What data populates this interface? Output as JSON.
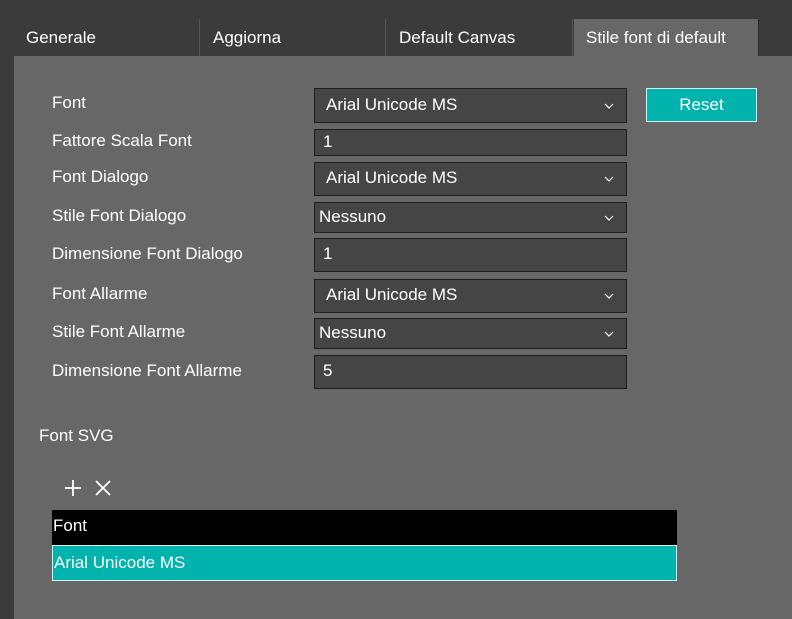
{
  "tabs": [
    {
      "label": "Generale"
    },
    {
      "label": "Aggiorna"
    },
    {
      "label": "Default Canvas"
    },
    {
      "label": "Stile font di default"
    }
  ],
  "active_tab": "Stile font di default",
  "form": {
    "font": {
      "label": "Font",
      "value": "Arial Unicode MS"
    },
    "font_scale": {
      "label": "Fattore Scala Font",
      "value": "1"
    },
    "dialog_font": {
      "label": "Font Dialogo",
      "value": "Arial Unicode MS"
    },
    "dialog_font_style": {
      "label": "Stile Font Dialogo",
      "value": "Nessuno"
    },
    "dialog_font_size": {
      "label": "Dimensione Font Dialogo",
      "value": "1"
    },
    "alarm_font": {
      "label": "Font Allarme",
      "value": "Arial Unicode MS"
    },
    "alarm_font_style": {
      "label": "Stile Font Allarme",
      "value": "Nessuno"
    },
    "alarm_font_size": {
      "label": "Dimensione Font Allarme",
      "value": "5"
    }
  },
  "reset_label": "Reset",
  "svg_section": {
    "title": "Font SVG",
    "add_icon": "plus-icon",
    "remove_icon": "close-icon",
    "table": {
      "header": "Font",
      "rows": [
        "Arial Unicode MS"
      ]
    }
  },
  "colors": {
    "accent": "#00b3ad",
    "panel": "#676767",
    "background": "#3b3b3b",
    "field": "#454545"
  }
}
